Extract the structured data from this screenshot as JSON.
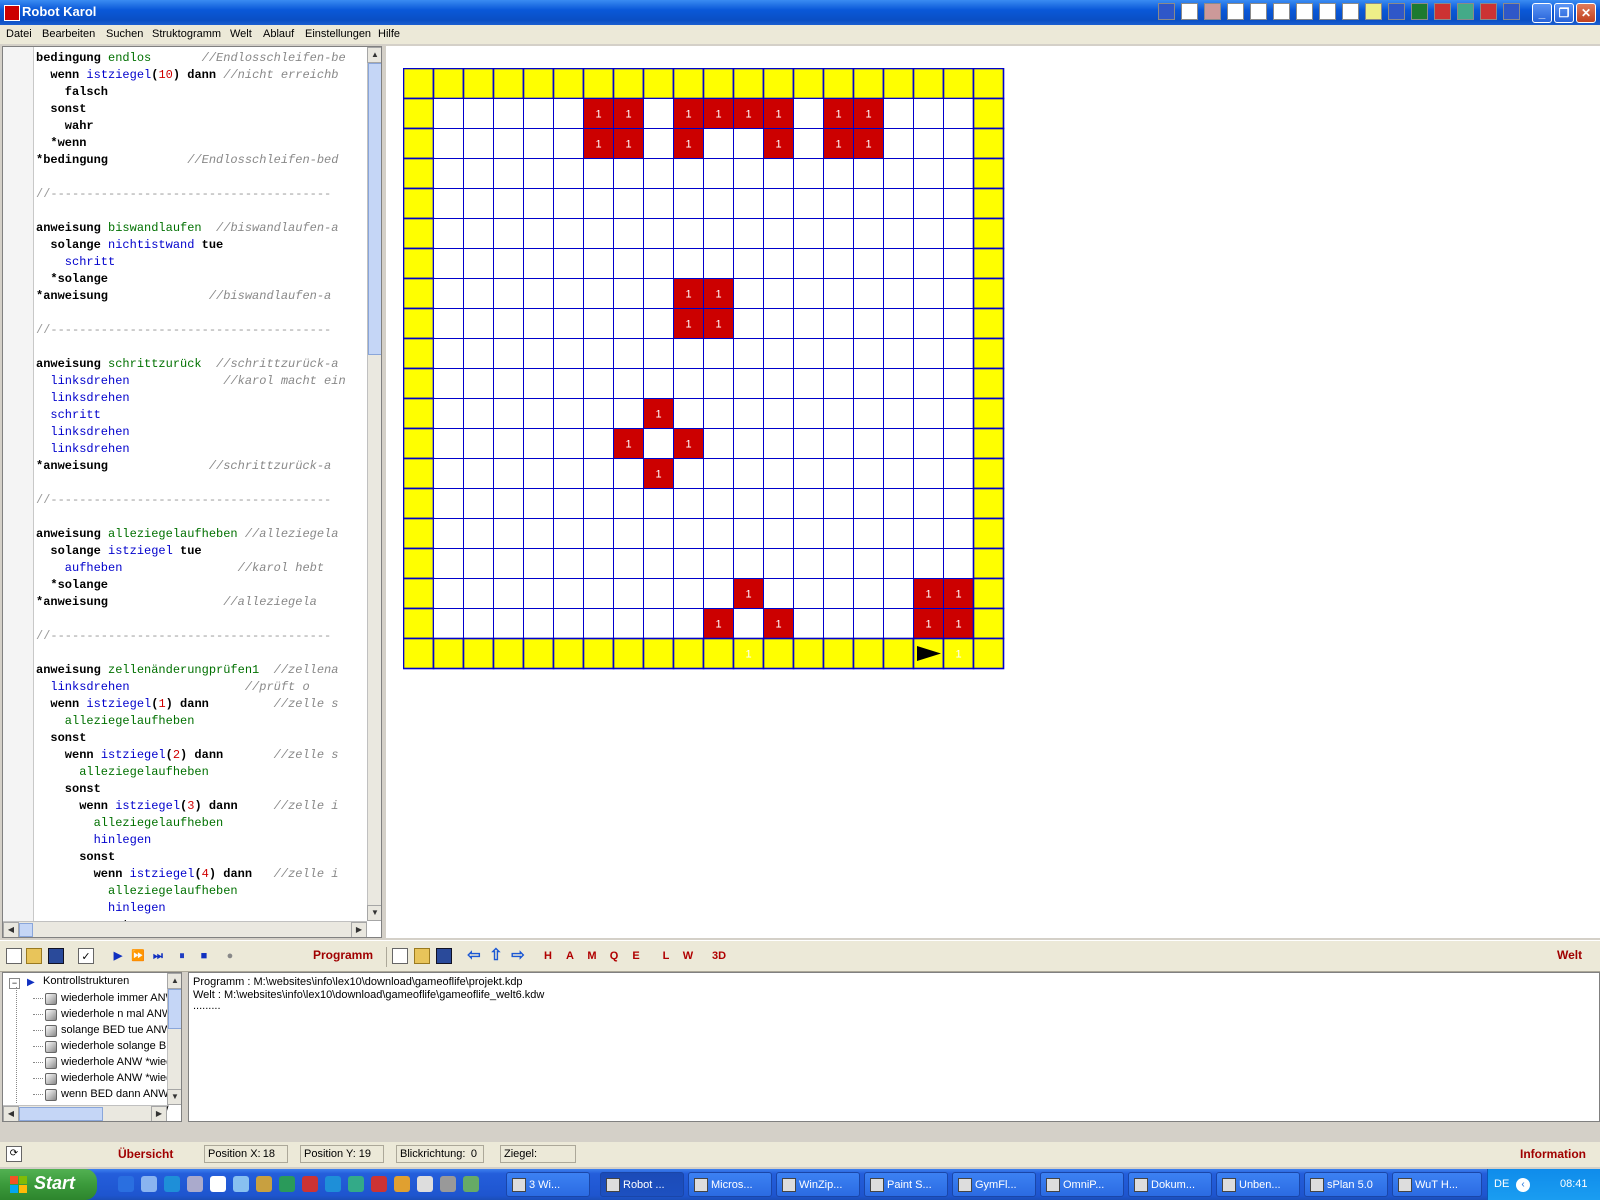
{
  "window": {
    "title": "Robot Karol"
  },
  "menu": [
    "Datei",
    "Bearbeiten",
    "Suchen",
    "Struktogramm",
    "Welt",
    "Ablauf",
    "Einstellungen",
    "Hilfe"
  ],
  "editor": {
    "lines": [
      [
        [
          "kw",
          "bedingung "
        ],
        [
          "nm",
          "endlos"
        ],
        [
          "cm",
          "       //Endlosschleifen-be"
        ]
      ],
      [
        [
          "kw",
          "  wenn "
        ],
        [
          "cl",
          "istziegel"
        ],
        [
          "kw",
          "("
        ],
        [
          "nu",
          "10"
        ],
        [
          "kw",
          ") dann "
        ],
        [
          "cm",
          "//nicht erreichb"
        ]
      ],
      [
        [
          "kw",
          "    falsch"
        ]
      ],
      [
        [
          "kw",
          "  sonst"
        ]
      ],
      [
        [
          "kw",
          "    wahr"
        ]
      ],
      [
        [
          "kw",
          "  *wenn"
        ]
      ],
      [
        [
          "kw",
          "*bedingung"
        ],
        [
          "cm",
          "           //Endlosschleifen-bed"
        ]
      ],
      [],
      [
        [
          "sep",
          "//---------------------------------------"
        ]
      ],
      [],
      [
        [
          "kw",
          "anweisung "
        ],
        [
          "nm",
          "biswandlaufen"
        ],
        [
          "cm",
          "  //biswandlaufen-a"
        ]
      ],
      [
        [
          "kw",
          "  solange "
        ],
        [
          "cl",
          "nichtistwand"
        ],
        [
          "kw",
          " tue"
        ]
      ],
      [
        [
          "cl",
          "    schritt"
        ]
      ],
      [
        [
          "kw",
          "  *solange"
        ]
      ],
      [
        [
          "kw",
          "*anweisung"
        ],
        [
          "cm",
          "              //biswandlaufen-a"
        ]
      ],
      [],
      [
        [
          "sep",
          "//---------------------------------------"
        ]
      ],
      [],
      [
        [
          "kw",
          "anweisung "
        ],
        [
          "nm",
          "schrittzurück"
        ],
        [
          "cm",
          "  //schrittzurück-a"
        ]
      ],
      [
        [
          "cl",
          "  linksdrehen"
        ],
        [
          "cm",
          "             //karol macht ein"
        ]
      ],
      [
        [
          "cl",
          "  linksdrehen"
        ]
      ],
      [
        [
          "cl",
          "  schritt"
        ]
      ],
      [
        [
          "cl",
          "  linksdrehen"
        ]
      ],
      [
        [
          "cl",
          "  linksdrehen"
        ]
      ],
      [
        [
          "kw",
          "*anweisung"
        ],
        [
          "cm",
          "              //schrittzurück-a"
        ]
      ],
      [],
      [
        [
          "sep",
          "//---------------------------------------"
        ]
      ],
      [],
      [
        [
          "kw",
          "anweisung "
        ],
        [
          "nm",
          "alleziegelaufheben"
        ],
        [
          "cm",
          " //alleziegela"
        ]
      ],
      [
        [
          "kw",
          "  solange "
        ],
        [
          "cl",
          "istziegel"
        ],
        [
          "kw",
          " tue"
        ]
      ],
      [
        [
          "cl",
          "    aufheben"
        ],
        [
          "cm",
          "                //karol hebt"
        ]
      ],
      [
        [
          "kw",
          "  *solange"
        ]
      ],
      [
        [
          "kw",
          "*anweisung"
        ],
        [
          "cm",
          "                //alleziegela"
        ]
      ],
      [],
      [
        [
          "sep",
          "//---------------------------------------"
        ]
      ],
      [],
      [
        [
          "kw",
          "anweisung "
        ],
        [
          "nm",
          "zellenänderungprüfen1"
        ],
        [
          "cm",
          "  //zellena"
        ]
      ],
      [
        [
          "cl",
          "  linksdrehen"
        ],
        [
          "cm",
          "                //prüft o"
        ]
      ],
      [
        [
          "kw",
          "  wenn "
        ],
        [
          "cl",
          "istziegel"
        ],
        [
          "kw",
          "("
        ],
        [
          "nu",
          "1"
        ],
        [
          "kw",
          ") dann"
        ],
        [
          "cm",
          "         //zelle s"
        ]
      ],
      [
        [
          "nm",
          "    alleziegelaufheben"
        ]
      ],
      [
        [
          "kw",
          "  sonst"
        ]
      ],
      [
        [
          "kw",
          "    wenn "
        ],
        [
          "cl",
          "istziegel"
        ],
        [
          "kw",
          "("
        ],
        [
          "nu",
          "2"
        ],
        [
          "kw",
          ") dann"
        ],
        [
          "cm",
          "       //zelle s"
        ]
      ],
      [
        [
          "nm",
          "      alleziegelaufheben"
        ]
      ],
      [
        [
          "kw",
          "    sonst"
        ]
      ],
      [
        [
          "kw",
          "      wenn "
        ],
        [
          "cl",
          "istziegel"
        ],
        [
          "kw",
          "("
        ],
        [
          "nu",
          "3"
        ],
        [
          "kw",
          ") dann"
        ],
        [
          "cm",
          "     //zelle i"
        ]
      ],
      [
        [
          "nm",
          "        alleziegelaufheben"
        ]
      ],
      [
        [
          "cl",
          "        hinlegen"
        ]
      ],
      [
        [
          "kw",
          "      sonst"
        ]
      ],
      [
        [
          "kw",
          "        wenn "
        ],
        [
          "cl",
          "istziegel"
        ],
        [
          "kw",
          "("
        ],
        [
          "nu",
          "4"
        ],
        [
          "kw",
          ") dann"
        ],
        [
          "cm",
          "   //zelle i"
        ]
      ],
      [
        [
          "nm",
          "          alleziegelaufheben"
        ]
      ],
      [
        [
          "cl",
          "          hinlegen"
        ]
      ],
      [
        [
          "kw",
          "        sonst"
        ]
      ]
    ]
  },
  "world": {
    "cols": 18,
    "rows": 18,
    "brick_label": "1",
    "colors": {
      "wall": "#ffff00",
      "brick": "#cc0000",
      "grid": "#0000cc",
      "robot": "#000000"
    },
    "bricks": [
      [
        6,
        1
      ],
      [
        7,
        1
      ],
      [
        9,
        1
      ],
      [
        10,
        1
      ],
      [
        11,
        1
      ],
      [
        12,
        1
      ],
      [
        14,
        1
      ],
      [
        15,
        1
      ],
      [
        6,
        2
      ],
      [
        7,
        2
      ],
      [
        9,
        2
      ],
      [
        12,
        2
      ],
      [
        14,
        2
      ],
      [
        15,
        2
      ],
      [
        9,
        7
      ],
      [
        10,
        7
      ],
      [
        9,
        8
      ],
      [
        10,
        8
      ],
      [
        8,
        11
      ],
      [
        7,
        12
      ],
      [
        9,
        12
      ],
      [
        8,
        13
      ],
      [
        11,
        17
      ],
      [
        17,
        17
      ],
      [
        18,
        17
      ],
      [
        10,
        18
      ],
      [
        12,
        18
      ],
      [
        17,
        18
      ],
      [
        18,
        18
      ],
      [
        11,
        19
      ],
      [
        18,
        19
      ]
    ],
    "robot": {
      "x": 17,
      "y": 19,
      "direction": "east"
    }
  },
  "toolbar": {
    "program_label": "Programm",
    "world_label": "Welt",
    "world_buttons": [
      "H",
      "A",
      "M",
      "Q",
      "E",
      "L",
      "W",
      "3D"
    ]
  },
  "tree": {
    "root": "Kontrollstrukturen",
    "items": [
      "wiederhole immer ANW",
      "wiederhole n mal ANW",
      "solange BED tue ANW",
      "wiederhole solange BE",
      "wiederhole ANW *wied",
      "wiederhole ANW *wied",
      "wenn BED dann ANW",
      "wenn BED dann ANW"
    ]
  },
  "messages": [
    "Programm : M:\\websites\\info\\lex10\\download\\gameoflife\\projekt.kdp",
    "Welt : M:\\websites\\info\\lex10\\download\\gameoflife\\gameoflife_welt6.kdw",
    "........."
  ],
  "status": {
    "overview": "Übersicht",
    "pos_x_label": "Position X:",
    "pos_x": "18",
    "pos_y_label": "Position Y:",
    "pos_y": "19",
    "direction_label": "Blickrichtung:",
    "direction": "0",
    "bricks_label": "Ziegel:",
    "information": "Information"
  },
  "taskbar": {
    "start": "Start",
    "tasks": [
      "3 Wi...",
      "Robot ...",
      "Micros...",
      "WinZip...",
      "Paint S...",
      "GymFl...",
      "OmniP...",
      "Dokum...",
      "Unben...",
      "sPlan 5.0",
      "WuT H..."
    ],
    "tray_lang": "DE",
    "clock": "08:41"
  }
}
